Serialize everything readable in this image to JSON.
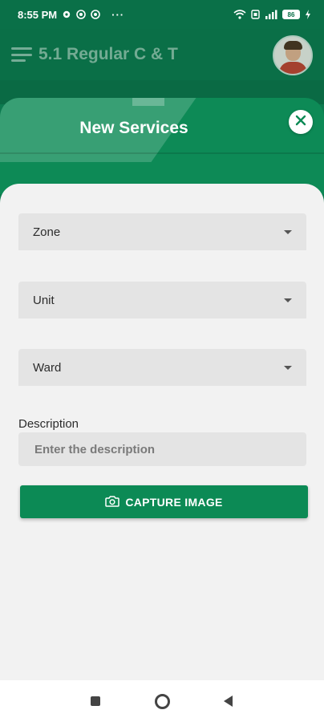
{
  "status_bar": {
    "time": "8:55 PM",
    "more": "···",
    "battery": "86"
  },
  "app_bar": {
    "title": "5.1 Regular C & T"
  },
  "sheet": {
    "title": "New Services"
  },
  "form": {
    "zone_label": "Zone",
    "unit_label": "Unit",
    "ward_label": "Ward",
    "description_label": "Description",
    "description_placeholder": "Enter the description",
    "description_value": "",
    "capture_button_label": "CAPTURE IMAGE"
  },
  "colors": {
    "primary": "#0c8a55",
    "primary_dark": "#0a7048",
    "panel_bg": "#f2f2f2",
    "field_bg": "#e4e4e4"
  },
  "icons": {
    "menu": "hamburger-icon",
    "close": "close-icon",
    "camera": "camera-icon",
    "dropdown": "triangle-down-icon"
  }
}
